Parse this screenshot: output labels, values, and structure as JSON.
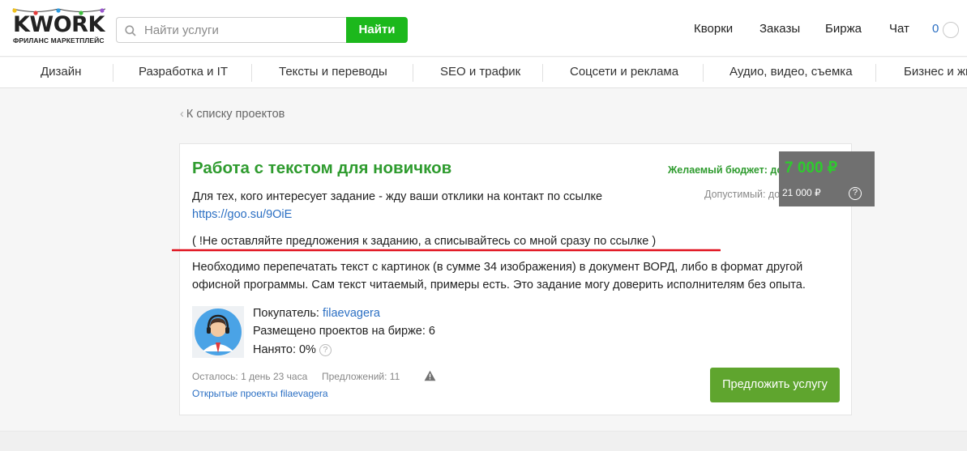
{
  "header": {
    "logo_text": "KWORK",
    "logo_subtitle": "ФРИЛАНС МАРКЕТПЛЕЙС",
    "search_placeholder": "Найти услуги",
    "search_button": "Найти",
    "nav": [
      "Кворки",
      "Заказы",
      "Биржа",
      "Чат"
    ],
    "balance": "0"
  },
  "categories": [
    "Дизайн",
    "Разработка и IT",
    "Тексты и переводы",
    "SEO и трафик",
    "Соцсети и реклама",
    "Аудио, видео, съемка",
    "Бизнес и жи"
  ],
  "back_link": "К списку проектов",
  "project": {
    "title": "Работа с текстом для новичков",
    "budget_label": "Желаемый бюджет: до",
    "budget_value": "7 000 ₽",
    "allowed_label": "Допустимый: до",
    "allowed_value": "21 000 ₽",
    "help_icon": "?",
    "description_line1": "Для тех, кого интересует задание - жду ваши отклики на контакт по ссылке",
    "description_link": "https://goo.su/9OiE",
    "description_line2": "( !Не оставляйте предложения к заданию, а списывайтесь со мной сразу по ссылке )",
    "description_line3": "Необходимо перепечатать текст с картинок (в сумме 34 изображения) в документ ВОРД, либо в формат другой",
    "description_line4": "офисной программы. Сам текст читаемый, примеры есть. Это задание могу доверить исполнителям без опыта.",
    "buyer_label": "Покупатель:",
    "buyer_name": "filaevagera",
    "posted_label": "Размещено проектов на бирже: 6",
    "hired_label": "Нанято: 0%",
    "time_left": "Осталось: 1 день 23 часа",
    "offers": "Предложений: 11",
    "open_projects_link": "Открытые проекты filaevagera",
    "offer_button": "Предложить услугу"
  },
  "colors": {
    "accent_green": "#1cb81c",
    "title_green": "#2e9b2e",
    "button_green": "#5fa52e",
    "link_blue": "#2b6fc3",
    "annotation_red": "#e0101c"
  }
}
